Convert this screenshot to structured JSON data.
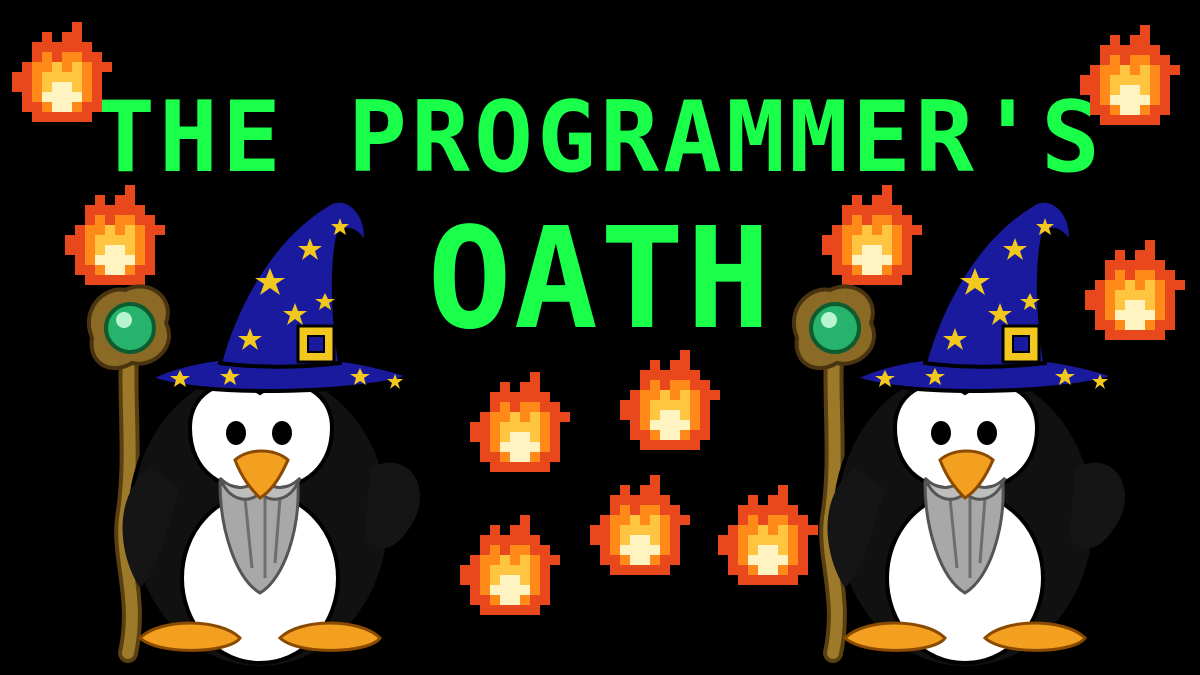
{
  "title": {
    "line1": "THE PROGRAMMER'S",
    "line2": "OATH"
  },
  "colors": {
    "background": "#000000",
    "title_text": "#19ff4a",
    "flame_outer": "#e8481b",
    "flame_mid": "#ff8a1a",
    "flame_core": "#fff3c2",
    "hat_blue": "#1a1a9e",
    "hat_star": "#f2c81e",
    "beak": "#f3a020",
    "beard": "#a8a8a8",
    "orb": "#27b36b",
    "staff": "#7a5a1e"
  },
  "icons": {
    "flame": "pixel-flame-icon",
    "wizard": "wizard-penguin-icon"
  }
}
